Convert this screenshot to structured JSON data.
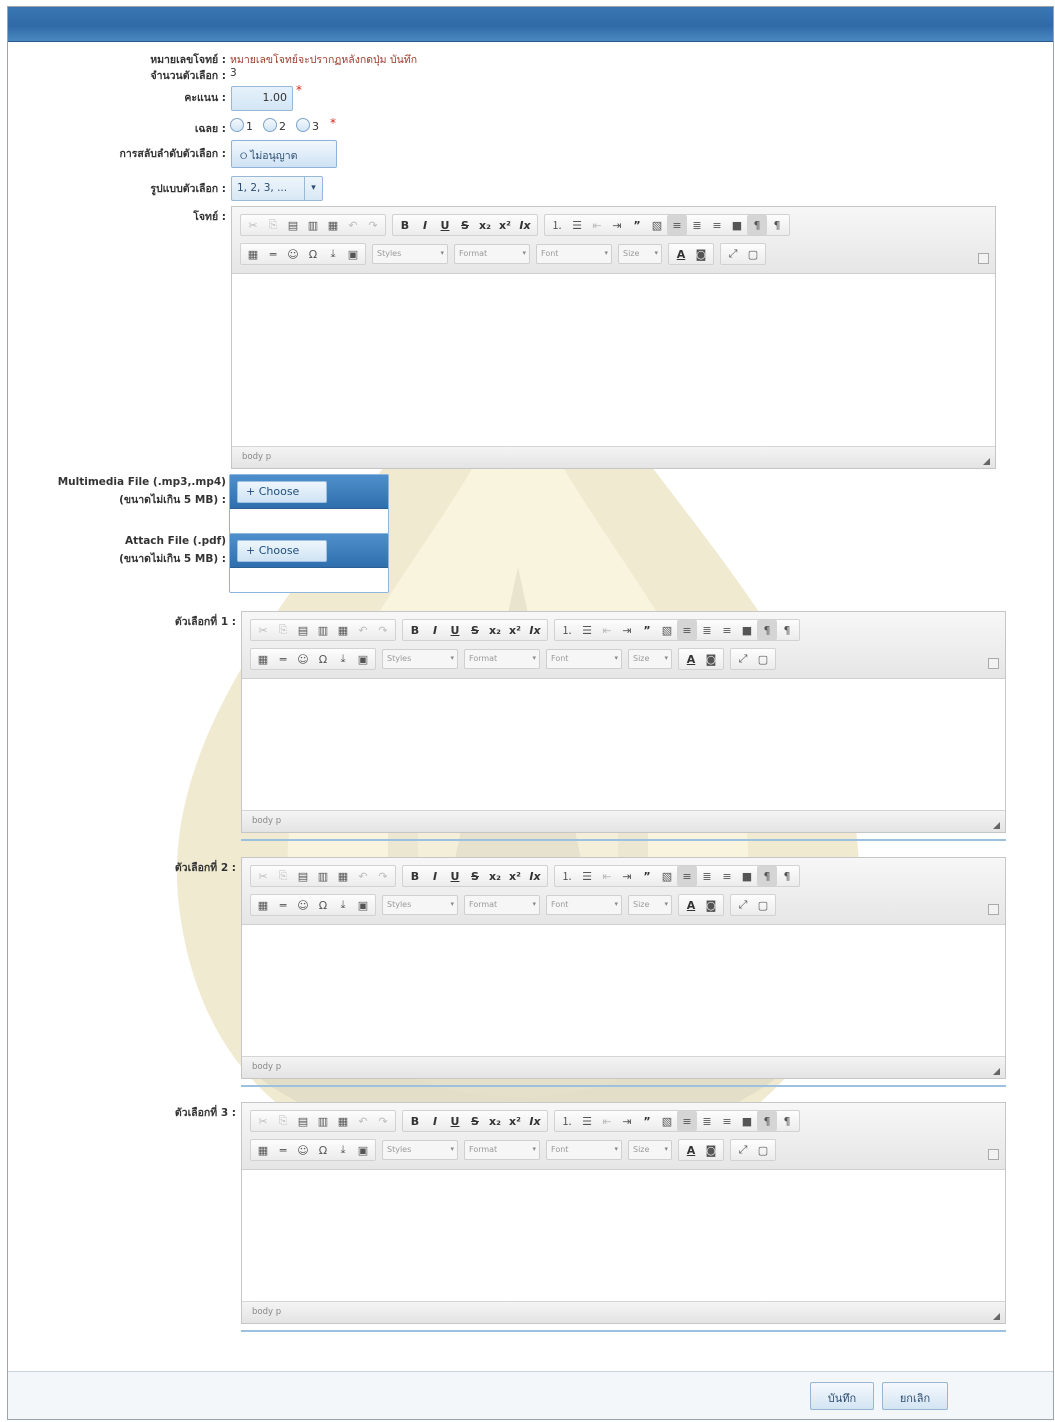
{
  "form": {
    "question_no_label": "หมายเลขโจทย์ :",
    "question_no_value": "หมายเลขโจทย์จะปรากฏหลังกดปุ่ม บันทึก",
    "choice_count_label": "จำนวนตัวเลือก :",
    "choice_count_value": "3",
    "score_label": "คะแนน :",
    "score_value": "1.00",
    "answer_label": "เฉลย :",
    "answer_options": [
      "1",
      "2",
      "3"
    ],
    "required_mark": "*",
    "shuffle_label": "การสลับลำดับตัวเลือก :",
    "shuffle_button": "ไม่อนุญาต",
    "choice_format_label": "รูปแบบตัวเลือก :",
    "choice_format_value": "1, 2, 3, ...",
    "question_label": "โจทย์ :",
    "multimedia_label": "Multimedia File (.mp3,.mp4)",
    "multimedia_sub": "(ขนาดไม่เกิน 5 MB) :",
    "attach_label": "Attach File (.pdf)",
    "attach_sub": "(ขนาดไม่เกิน 5 MB) :",
    "choose_label": "+ Choose",
    "choice1_label": "ตัวเลือกที่ 1 :",
    "choice2_label": "ตัวเลือกที่ 2 :",
    "choice3_label": "ตัวเลือกที่ 3 :"
  },
  "editor": {
    "combos": [
      "Styles",
      "Format",
      "Font",
      "Size"
    ],
    "path": "body  p"
  },
  "footer": {
    "save": "บันทึก",
    "cancel": "ยกเลิก"
  },
  "colors": {
    "header_blue": "#2f6aa6",
    "required_red": "#d9261c",
    "question_no_color": "#9c3a2a"
  }
}
